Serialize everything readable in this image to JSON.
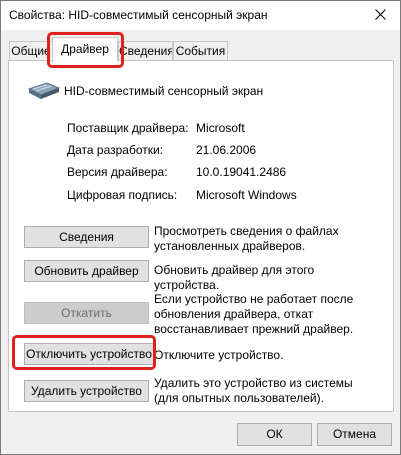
{
  "window": {
    "title": "Свойства: HID-совместимый сенсорный экран"
  },
  "tabs": [
    {
      "label": "Общие"
    },
    {
      "label": "Драйвер"
    },
    {
      "label": "Сведения"
    },
    {
      "label": "События"
    }
  ],
  "device": {
    "name": "HID-совместимый сенсорный экран"
  },
  "properties": [
    {
      "label": "Поставщик драйвера:",
      "value": "Microsoft"
    },
    {
      "label": "Дата разработки:",
      "value": "21.06.2006"
    },
    {
      "label": "Версия драйвера:",
      "value": "10.0.19041.2486"
    },
    {
      "label": "Цифровая подпись:",
      "value": "Microsoft Windows"
    }
  ],
  "actions": [
    {
      "button": "Сведения",
      "description": "Просмотреть сведения о файлах установленных драйверов."
    },
    {
      "button": "Обновить драйвер",
      "description": "Обновить драйвер для этого устройства."
    },
    {
      "button": "Откатить",
      "description": "Если устройство не работает после обновления драйвера, откат восстанавливает прежний драйвер."
    },
    {
      "button": "Отключить устройство",
      "description": "Отключите устройство."
    },
    {
      "button": "Удалить устройство",
      "description": "Удалить это устройство из системы (для опытных пользователей)."
    }
  ],
  "footer": {
    "ok": "ОК",
    "cancel": "Отмена"
  },
  "colors": {
    "highlight": "#e0201b",
    "window_bg": "#f0f0f0"
  }
}
